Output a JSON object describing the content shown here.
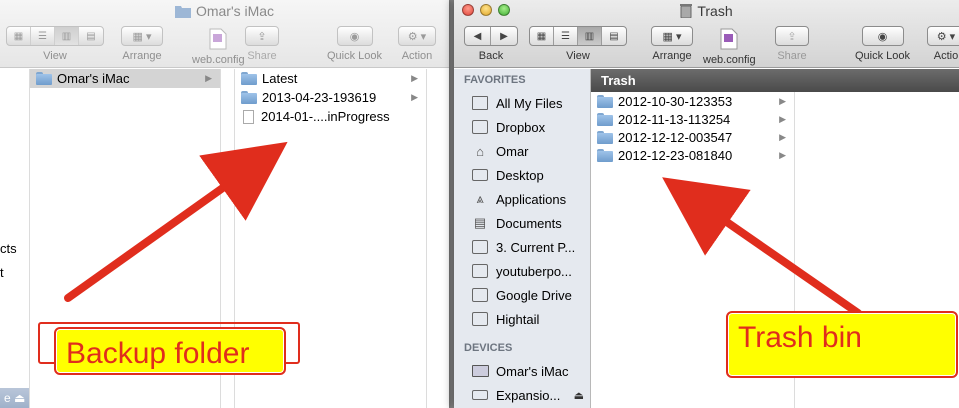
{
  "left_window": {
    "title": "Omar's iMac",
    "toolbar": {
      "view_label": "View",
      "arrange_label": "Arrange",
      "webconfig_label": "web.config",
      "share_label": "Share",
      "quicklook_label": "Quick Look",
      "action_label": "Action"
    },
    "left_fragments": [
      "cts",
      "t"
    ],
    "bottom_fragment": "e",
    "col1": {
      "items": [
        {
          "name": "Omar's iMac"
        }
      ]
    },
    "col2": {
      "items": [
        {
          "name": "Latest"
        },
        {
          "name": "2013-04-23-193619"
        },
        {
          "name": "2014-01-....inProgress"
        }
      ]
    }
  },
  "right_window": {
    "title": "Trash",
    "toolbar": {
      "back_label": "Back",
      "view_label": "View",
      "arrange_label": "Arrange",
      "webconfig_label": "web.config",
      "share_label": "Share",
      "quicklook_label": "Quick Look",
      "action_label": "Actio"
    },
    "sidebar": {
      "favorites_header": "FAVORITES",
      "favorites": [
        {
          "label": "All My Files",
          "icon": "all-files-icon"
        },
        {
          "label": "Dropbox",
          "icon": "folder-icon"
        },
        {
          "label": "Omar",
          "icon": "home-icon"
        },
        {
          "label": "Desktop",
          "icon": "desktop-icon"
        },
        {
          "label": "Applications",
          "icon": "applications-icon"
        },
        {
          "label": "Documents",
          "icon": "documents-icon"
        },
        {
          "label": "3. Current P...",
          "icon": "folder-icon"
        },
        {
          "label": "youtuberpo...",
          "icon": "folder-icon"
        },
        {
          "label": "Google Drive",
          "icon": "folder-icon"
        },
        {
          "label": "Hightail",
          "icon": "folder-icon"
        }
      ],
      "devices_header": "DEVICES",
      "devices": [
        {
          "label": "Omar's iMac",
          "icon": "imac-icon"
        },
        {
          "label": "Expansio...",
          "icon": "drive-icon"
        }
      ]
    },
    "pane_header": "Trash",
    "items": [
      {
        "name": "2012-10-30-123353"
      },
      {
        "name": "2012-11-13-113254"
      },
      {
        "name": "2012-12-12-003547"
      },
      {
        "name": "2012-12-23-081840"
      }
    ]
  },
  "annotations": {
    "backup_label": "Backup folder",
    "trash_label": "Trash bin",
    "callout_color": "#ffff00",
    "arrow_color": "#e02d1d"
  }
}
